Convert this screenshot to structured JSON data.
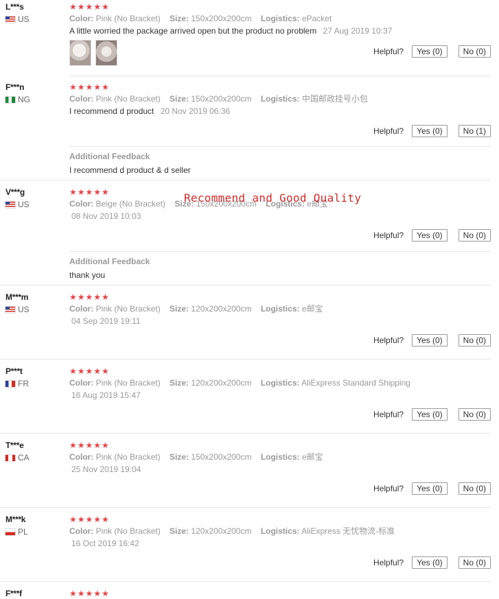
{
  "labels": {
    "color": "Color:",
    "size": "Size:",
    "logistics": "Logistics:",
    "helpful": "Helpful?",
    "additional_feedback": "Additional Feedback",
    "stars": "★★★★★"
  },
  "watermark": "Recommend and Good Quality",
  "reviews": [
    {
      "user": "L***s",
      "country": "US",
      "color": "Pink (No Bracket)",
      "size": "150x200x200cm",
      "logistics": "ePacket",
      "text": "A little worried the package arrived open but the product no problem",
      "date": "27 Aug 2019 10:37",
      "yes": "Yes (0)",
      "no": "No (0)"
    },
    {
      "user": "F***n",
      "country": "NG",
      "color": "Pink (No Bracket)",
      "size": "150x200x200cm",
      "logistics": "中国邮政挂号小包",
      "text": "I recommend d product",
      "date": "20 Nov 2019 06:36",
      "yes": "Yes (0)",
      "no": "No (1)",
      "additional": "I recommend d product & d seller"
    },
    {
      "user": "V***g",
      "country": "US",
      "color": "Beige (No Bracket)",
      "size": "150x200x200cm",
      "logistics": "e邮宝",
      "date": "08 Nov 2019 10:03",
      "yes": "Yes (0)",
      "no": "No (0)",
      "additional": "thank you"
    },
    {
      "user": "M***m",
      "country": "US",
      "color": "Pink (No Bracket)",
      "size": "120x200x200cm",
      "logistics": "e邮宝",
      "date": "04 Sep 2019 19:11",
      "yes": "Yes (0)",
      "no": "No (0)"
    },
    {
      "user": "P***t",
      "country": "FR",
      "color": "Pink (No Bracket)",
      "size": "120x200x200cm",
      "logistics": "AliExpress Standard Shipping",
      "date": "16 Aug 2019 15:47",
      "yes": "Yes (0)",
      "no": "No (0)"
    },
    {
      "user": "T***e",
      "country": "CA",
      "color": "Pink (No Bracket)",
      "size": "150x200x200cm",
      "logistics": "e邮宝",
      "date": "25 Nov 2019 19:04",
      "yes": "Yes (0)",
      "no": "No (0)"
    },
    {
      "user": "M***k",
      "country": "PL",
      "color": "Pink (No Bracket)",
      "size": "120x200x200cm",
      "logistics": "AliExpress 无忧物流-标准",
      "date": "16 Oct 2019 16:42",
      "yes": "Yes (0)",
      "no": "No (0)"
    },
    {
      "user": "F***f"
    }
  ]
}
